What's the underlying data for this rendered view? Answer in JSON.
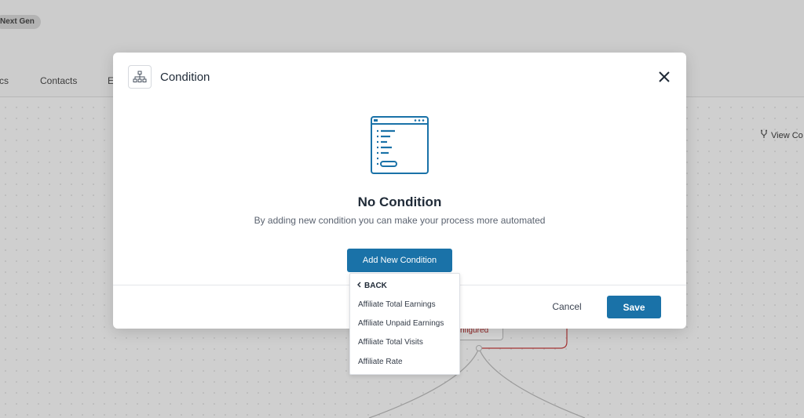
{
  "background": {
    "badge": "Next Gen",
    "nav_tabs": [
      "cs",
      "Contacts",
      "E"
    ],
    "view_link": "View Co",
    "node_status": "nfigured"
  },
  "modal": {
    "title": "Condition",
    "empty_title": "No Condition",
    "empty_description": "By adding new condition you can make your process more automated",
    "add_button": "Add New Condition",
    "cancel_button": "Cancel",
    "save_button": "Save"
  },
  "dropdown": {
    "back_label": "BACK",
    "items": [
      "Affiliate Total Earnings",
      "Affiliate Unpaid Earnings",
      "Affiliate Total Visits",
      "Affiliate Rate"
    ]
  },
  "colors": {
    "primary": "#1a72a8",
    "overlay": "#cfcfcf",
    "error_text": "#8f1f1f"
  },
  "icons": [
    "structure-icon",
    "close-icon",
    "chevron-left-icon",
    "branch-icon",
    "code-window-icon"
  ]
}
